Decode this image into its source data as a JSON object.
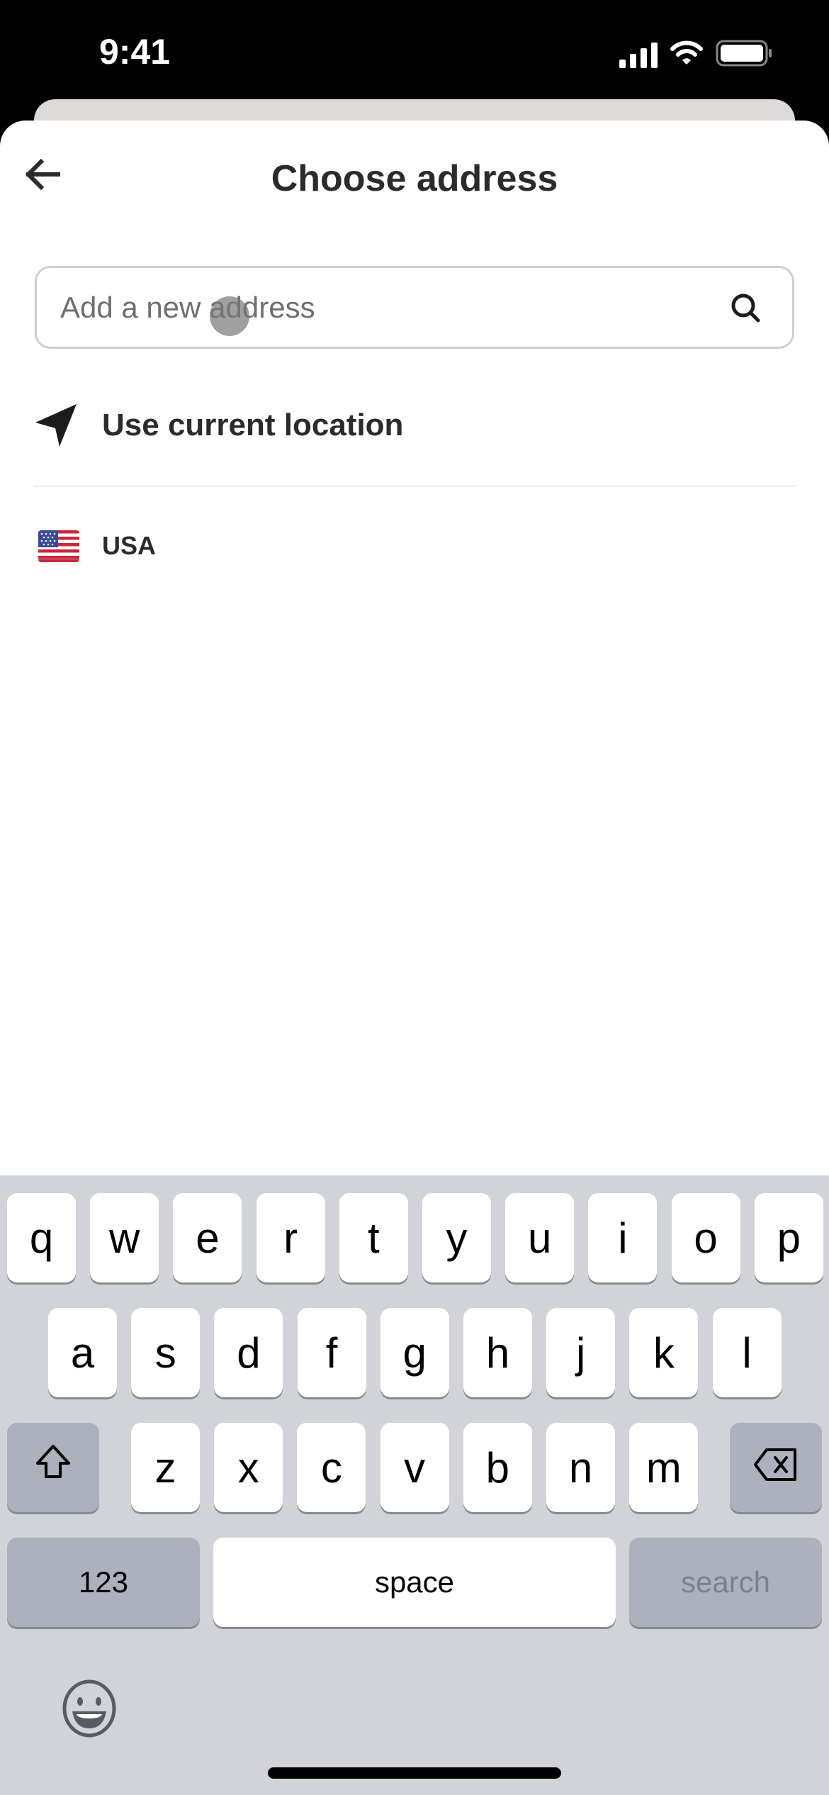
{
  "status_bar": {
    "time": "9:41",
    "icons": [
      "signal-icon",
      "wifi-icon",
      "battery-icon"
    ]
  },
  "header": {
    "title": "Choose address",
    "back_icon": "arrow-left-icon"
  },
  "search": {
    "placeholder": "Add a new address",
    "value": "",
    "icon": "search-icon"
  },
  "location": {
    "label": "Use current location",
    "icon": "navigation-arrow-icon"
  },
  "country": {
    "label": "USA",
    "icon": "us-flag-icon"
  },
  "keyboard": {
    "row1": [
      "q",
      "w",
      "e",
      "r",
      "t",
      "y",
      "u",
      "i",
      "o",
      "p"
    ],
    "row2": [
      "a",
      "s",
      "d",
      "f",
      "g",
      "h",
      "j",
      "k",
      "l"
    ],
    "row3": [
      "z",
      "x",
      "c",
      "v",
      "b",
      "n",
      "m"
    ],
    "shift_icon": "shift-icon",
    "delete_icon": "delete-icon",
    "numbers_label": "123",
    "space_label": "space",
    "search_label": "search",
    "emoji_icon": "emoji-icon"
  }
}
